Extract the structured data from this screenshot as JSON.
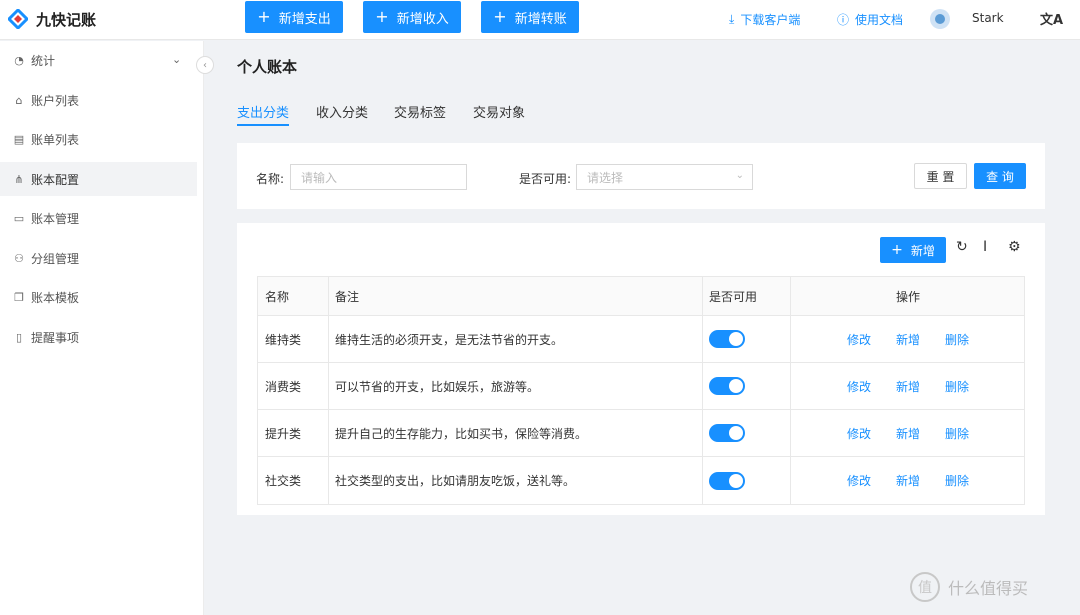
{
  "app": {
    "name": "九快记账"
  },
  "header": {
    "buttons": [
      "新增支出",
      "新增收入",
      "新增转账"
    ],
    "download_label": "下载客户端",
    "docs_label": "使用文档",
    "username": "Stark",
    "lang_icon": "文A"
  },
  "sidebar": {
    "items": [
      {
        "label": "统计",
        "icon": "pie-chart-icon"
      },
      {
        "label": "账户列表",
        "icon": "bank-icon"
      },
      {
        "label": "账单列表",
        "icon": "file-icon"
      },
      {
        "label": "账本配置",
        "icon": "sitemap-icon"
      },
      {
        "label": "账本管理",
        "icon": "folder-icon"
      },
      {
        "label": "分组管理",
        "icon": "users-icon"
      },
      {
        "label": "账本模板",
        "icon": "copy-icon"
      },
      {
        "label": "提醒事项",
        "icon": "note-icon"
      }
    ]
  },
  "page": {
    "title": "个人账本",
    "tabs": [
      "支出分类",
      "收入分类",
      "交易标签",
      "交易对象"
    ]
  },
  "search": {
    "name_label": "名称:",
    "name_placeholder": "请输入",
    "enabled_label": "是否可用:",
    "enabled_placeholder": "请选择",
    "reset_label": "重 置",
    "query_label": "查 询"
  },
  "toolbar": {
    "add_label": "新增"
  },
  "table": {
    "columns": [
      "名称",
      "备注",
      "是否可用",
      "操作"
    ],
    "rows": [
      {
        "name": "维持类",
        "note": "维持生活的必须开支，是无法节省的开支。",
        "enabled": true
      },
      {
        "name": "消费类",
        "note": "可以节省的开支，比如娱乐，旅游等。",
        "enabled": true
      },
      {
        "name": "提升类",
        "note": "提升自己的生存能力，比如买书，保险等消费。",
        "enabled": true
      },
      {
        "name": "社交类",
        "note": "社交类型的支出，比如请朋友吃饭，送礼等。",
        "enabled": true
      }
    ],
    "actions": [
      "修改",
      "新增",
      "删除"
    ]
  },
  "watermark": {
    "text": "什么值得买",
    "mark": "值"
  },
  "colors": {
    "primary": "#1890ff"
  }
}
